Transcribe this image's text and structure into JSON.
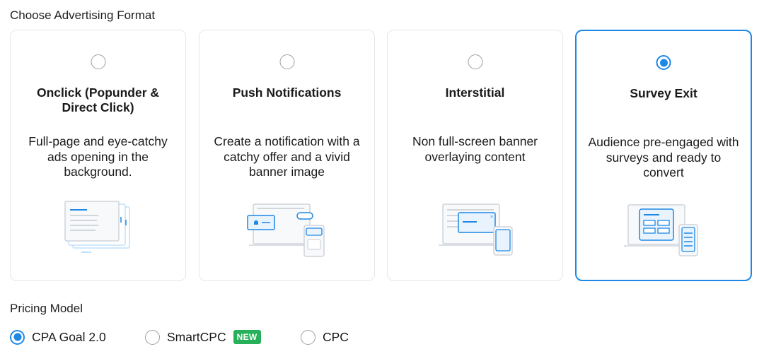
{
  "format_section": {
    "title": "Choose Advertising Format",
    "cards": [
      {
        "title": "Onclick (Popunder & Direct Click)",
        "description": "Full-page and eye-catchy ads opening in the background.",
        "selected": false,
        "icon": "popunder-illustration"
      },
      {
        "title": "Push Notifications",
        "description": "Create a notification with a catchy offer and a vivid banner image",
        "selected": false,
        "icon": "push-notification-illustration"
      },
      {
        "title": "Interstitial",
        "description": "Non full-screen banner overlaying content",
        "selected": false,
        "icon": "interstitial-illustration"
      },
      {
        "title": "Survey Exit",
        "description": "Audience pre-engaged with surveys and ready to convert",
        "selected": true,
        "icon": "survey-exit-illustration"
      }
    ]
  },
  "pricing_section": {
    "title": "Pricing Model",
    "options": [
      {
        "label": "CPA Goal 2.0",
        "selected": true
      },
      {
        "label": "SmartCPC",
        "selected": false,
        "badge": "NEW"
      },
      {
        "label": "CPC",
        "selected": false
      }
    ]
  },
  "colors": {
    "accent": "#1e88e5",
    "badge_green": "#27b05a",
    "card_border": "#e3e6ea"
  }
}
